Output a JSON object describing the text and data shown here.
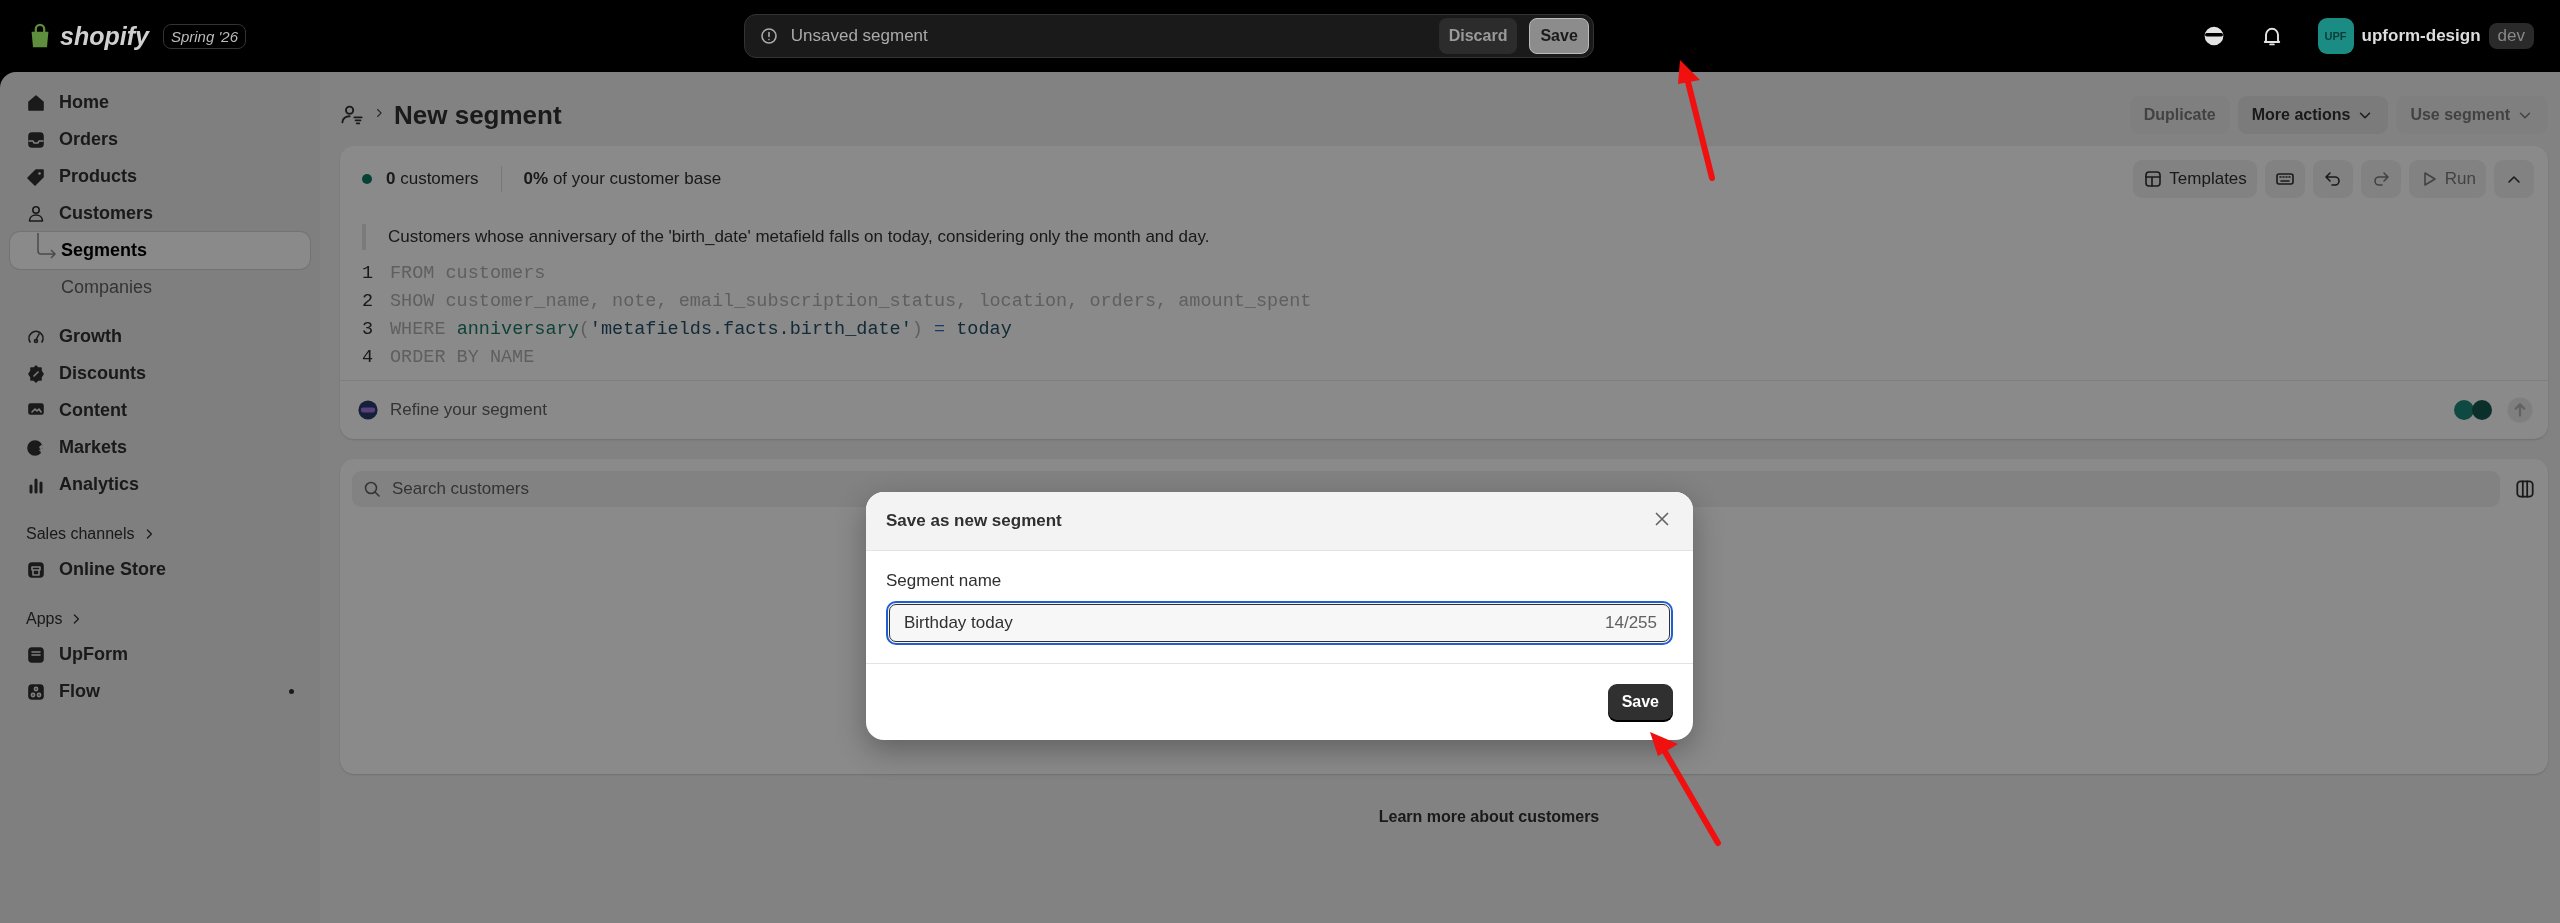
{
  "top_bar": {
    "brand": "shopify",
    "version": "Spring '26",
    "notice": "Unsaved segment",
    "discard": "Discard",
    "save": "Save",
    "store_avatar": "UPF",
    "store_name": "upform-design",
    "store_badge": "dev"
  },
  "sidebar": {
    "items": [
      {
        "label": "Home",
        "selected": false
      },
      {
        "label": "Orders",
        "selected": false
      },
      {
        "label": "Products",
        "selected": false
      },
      {
        "label": "Customers",
        "selected": false,
        "children": [
          {
            "label": "Segments",
            "selected": true
          },
          {
            "label": "Companies",
            "selected": false
          }
        ]
      },
      {
        "label": "Growth",
        "selected": false
      },
      {
        "label": "Discounts",
        "selected": false
      },
      {
        "label": "Content",
        "selected": false
      },
      {
        "label": "Markets",
        "selected": false
      },
      {
        "label": "Analytics",
        "selected": false
      }
    ],
    "sections": [
      {
        "title": "Sales channels",
        "items": [
          {
            "label": "Online Store",
            "notification": false
          }
        ]
      },
      {
        "title": "Apps",
        "items": [
          {
            "label": "UpForm",
            "notification": false
          },
          {
            "label": "Flow",
            "notification": true
          }
        ]
      }
    ]
  },
  "page": {
    "title": "New segment",
    "actions": [
      {
        "label": "Duplicate",
        "disabled": true,
        "menu": false
      },
      {
        "label": "More actions",
        "disabled": false,
        "menu": true
      },
      {
        "label": "Use segment",
        "disabled": true,
        "menu": true
      }
    ]
  },
  "editor": {
    "count": "**0** customers",
    "share": "**0%** of your customer base",
    "toolbar": [
      {
        "kind": "templates",
        "label": "Templates",
        "disabled": false
      },
      {
        "kind": "keyboard",
        "disabled": false
      },
      {
        "kind": "undo",
        "disabled": false
      },
      {
        "kind": "redo",
        "disabled": true
      },
      {
        "kind": "run",
        "label": "Run",
        "disabled": true
      },
      {
        "kind": "collapse",
        "disabled": false
      }
    ],
    "description": "Customers whose anniversary of the 'birth_date' metafield falls on today, considering only the month and day.",
    "lines": [
      {
        "number": "1",
        "tokens": [
          {
            "kind": "keyword",
            "text": "FROM customers"
          }
        ]
      },
      {
        "number": "2",
        "tokens": [
          {
            "kind": "keyword",
            "text": "SHOW customer_name, note, email_subscription_status, location, orders, amount_spent"
          }
        ]
      },
      {
        "number": "3",
        "tokens": [
          {
            "kind": "keyword",
            "text": "WHERE "
          },
          {
            "kind": "function",
            "text": "anniversary"
          },
          {
            "kind": "punct",
            "text": "("
          },
          {
            "kind": "string",
            "text": "'metafields.facts.birth_date'"
          },
          {
            "kind": "punct",
            "text": ")"
          },
          {
            "kind": "operator",
            "text": " = "
          },
          {
            "kind": "value",
            "text": "today"
          }
        ]
      },
      {
        "number": "4",
        "tokens": [
          {
            "kind": "keyword",
            "text": "ORDER BY NAME"
          }
        ]
      }
    ],
    "refine_placeholder": "Refine your segment"
  },
  "customers": {
    "search_placeholder": "Search customers"
  },
  "learn_more": "Learn more about customers",
  "dialog": {
    "title": "Save as new segment",
    "field_label": "Segment name",
    "field_value": "Birthday today",
    "counter": "14/255",
    "save": "Save"
  }
}
